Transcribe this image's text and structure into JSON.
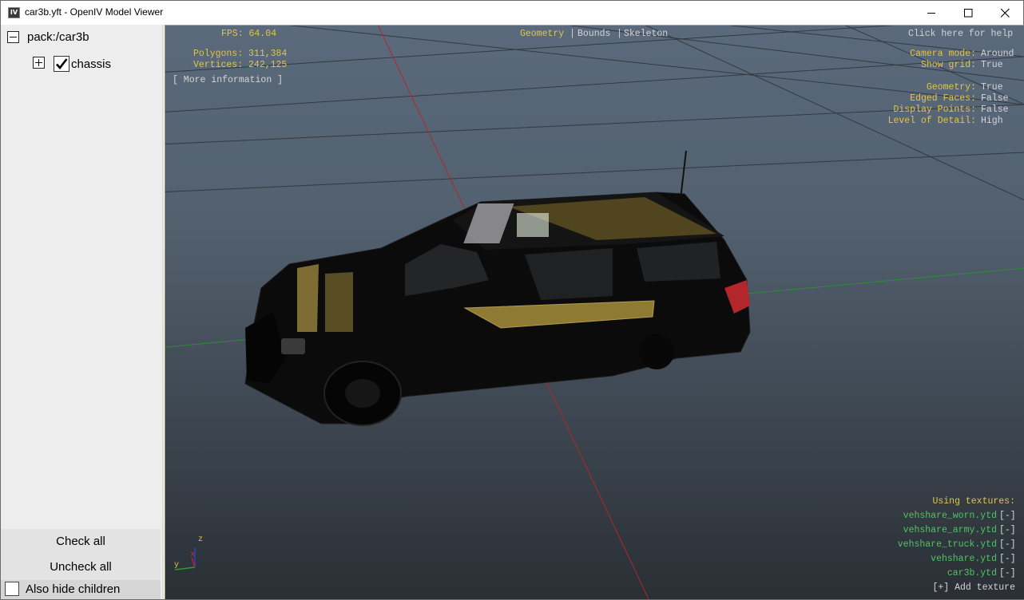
{
  "window": {
    "title": "car3b.yft - OpenIV Model Viewer",
    "app_icon": "IV"
  },
  "titlebar_icons": {
    "minimize": "minimize-icon",
    "maximize": "maximize-icon",
    "close": "close-icon"
  },
  "sidebar": {
    "root_label": "pack:/car3b",
    "child_label": "chassis",
    "check_all": "Check all",
    "uncheck_all": "Uncheck all",
    "hide_children": "Also hide children"
  },
  "overlay": {
    "fps": "FPS: 64.04",
    "polygons": "Polygons: 311,384",
    "vertices": "Vertices: 242,125",
    "more_info": "[ More information ]",
    "modes": {
      "geometry": "Geometry",
      "sep1": "|",
      "bounds": "Bounds",
      "sep2": "|",
      "skeleton": "Skeleton"
    },
    "help": "Click here for help",
    "settings": [
      {
        "label": "Camera mode:",
        "value": "Around"
      },
      {
        "label": "Show grid:",
        "value": "True"
      },
      {
        "label": "Geometry:",
        "value": "True"
      },
      {
        "label": "Edged Faces:",
        "value": "False"
      },
      {
        "label": "Display Points:",
        "value": "False"
      },
      {
        "label": "Level of Detail:",
        "value": "High"
      }
    ],
    "textures_header": "Using textures:",
    "textures": [
      {
        "name": "vehshare_worn.ytd",
        "remove": "[-]"
      },
      {
        "name": "vehshare_army.ytd",
        "remove": "[-]"
      },
      {
        "name": "vehshare_truck.ytd",
        "remove": "[-]"
      },
      {
        "name": "vehshare.ytd",
        "remove": "[-]"
      },
      {
        "name": "car3b.ytd",
        "remove": "[-]"
      }
    ],
    "add_texture": "[+] Add texture",
    "axis": {
      "z": "z",
      "y": "y",
      "x": "x"
    }
  },
  "colors": {
    "overlay_label": "#e2c44a",
    "overlay_value": "#d4d4d4",
    "texture_link": "#4fc462",
    "viewport_top": "#5a6a7c",
    "viewport_bottom": "#2a2f35"
  }
}
